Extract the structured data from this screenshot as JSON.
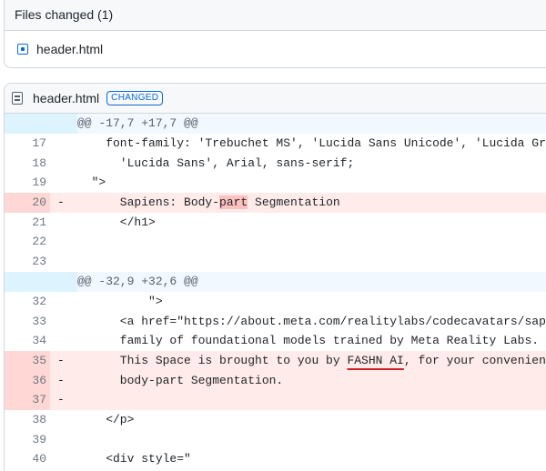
{
  "files_panel": {
    "title": "Files changed (1)",
    "files": [
      {
        "name": "header.html"
      }
    ]
  },
  "diff": {
    "filename": "header.html",
    "status_badge": "CHANGED",
    "lines": [
      {
        "type": "hunk",
        "num": "",
        "marker": "",
        "code": "@@ -17,7 +17,7 @@"
      },
      {
        "type": "ctx",
        "num": "17",
        "marker": "",
        "code": "    font-family: 'Trebuchet MS', 'Lucida Sans Unicode', 'Lucida Grande',"
      },
      {
        "type": "ctx",
        "num": "18",
        "marker": "",
        "code": "      'Lucida Sans', Arial, sans-serif;"
      },
      {
        "type": "ctx",
        "num": "19",
        "marker": "",
        "code": "  \">"
      },
      {
        "type": "del",
        "num": "20",
        "marker": "-",
        "code_pre": "      Sapiens: Body-",
        "code_hl": "part",
        "code_post": " Segmentation"
      },
      {
        "type": "ctx",
        "num": "21",
        "marker": "",
        "code": "      </h1>"
      },
      {
        "type": "ctx",
        "num": "22",
        "marker": "",
        "code": ""
      },
      {
        "type": "ctx",
        "num": "23",
        "marker": "",
        "code": ""
      },
      {
        "type": "hunk",
        "num": "",
        "marker": "",
        "code": "@@ -32,9 +32,6 @@"
      },
      {
        "type": "ctx",
        "num": "32",
        "marker": "",
        "code": "          \">"
      },
      {
        "type": "ctx",
        "num": "33",
        "marker": "",
        "code": "      <a href=\"https://about.meta.com/realitylabs/codecavatars/sapiens\""
      },
      {
        "type": "ctx",
        "num": "34",
        "marker": "",
        "code": "      family of foundational models trained by Meta Reality Labs. <"
      },
      {
        "type": "del",
        "num": "35",
        "marker": "-",
        "code_pre": "      This Space is brought to you by ",
        "code_hl": "FASHN AI",
        "code_post": ", for your convenience"
      },
      {
        "type": "del",
        "num": "36",
        "marker": "-",
        "code": "      body-part Segmentation."
      },
      {
        "type": "del",
        "num": "37",
        "marker": "-",
        "code": ""
      },
      {
        "type": "ctx",
        "num": "38",
        "marker": "",
        "code": "    </p>"
      },
      {
        "type": "ctx",
        "num": "39",
        "marker": "",
        "code": ""
      },
      {
        "type": "ctx",
        "num": "40",
        "marker": "",
        "code": "    <div style=\""
      }
    ]
  }
}
